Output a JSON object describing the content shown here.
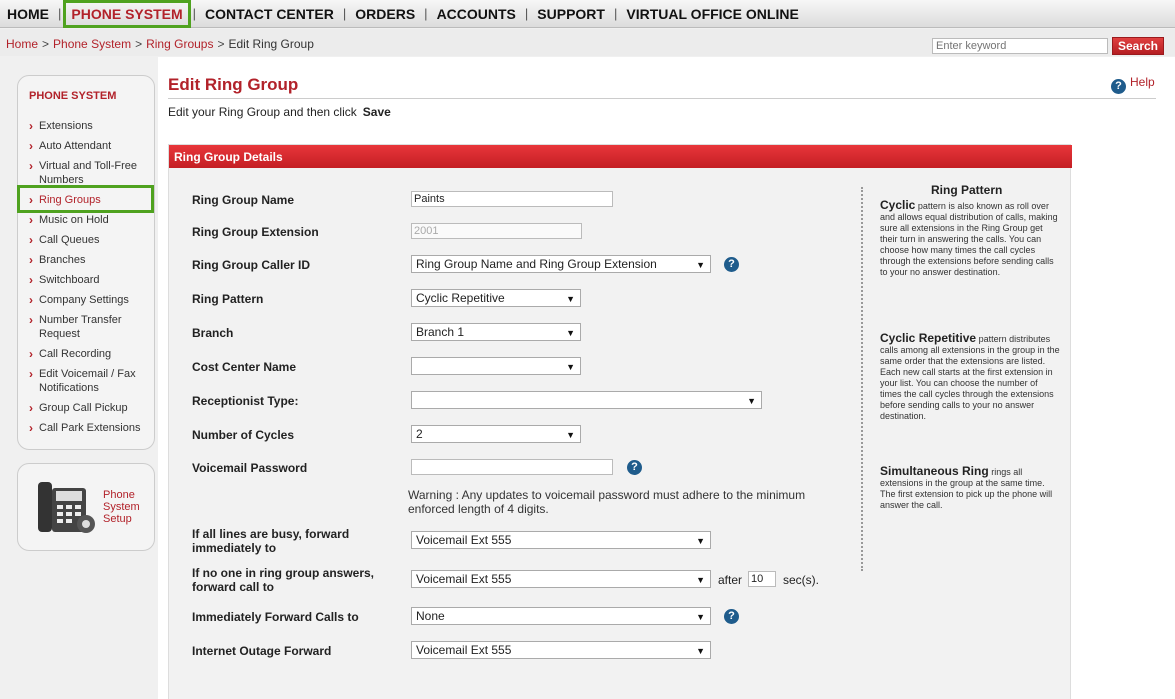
{
  "nav": {
    "items": [
      {
        "label": "HOME"
      },
      {
        "label": "PHONE SYSTEM"
      },
      {
        "label": "CONTACT CENTER"
      },
      {
        "label": "ORDERS"
      },
      {
        "label": "ACCOUNTS"
      },
      {
        "label": "SUPPORT"
      },
      {
        "label": "VIRTUAL OFFICE ONLINE"
      }
    ],
    "active": "PHONE SYSTEM"
  },
  "breadcrumb": {
    "items": [
      "Home",
      "Phone System",
      "Ring Groups"
    ],
    "current": "Edit Ring Group",
    "separator": ">"
  },
  "search": {
    "placeholder": "Enter keyword",
    "button": "Search"
  },
  "sidebar": {
    "title": "PHONE SYSTEM",
    "items": [
      {
        "label": "Extensions"
      },
      {
        "label": "Auto Attendant"
      },
      {
        "label": "Virtual and Toll-Free Numbers"
      },
      {
        "label": "Ring Groups"
      },
      {
        "label": "Music on Hold"
      },
      {
        "label": "Call Queues"
      },
      {
        "label": "Branches"
      },
      {
        "label": "Switchboard"
      },
      {
        "label": "Company Settings"
      },
      {
        "label": "Number Transfer Request"
      },
      {
        "label": "Call Recording"
      },
      {
        "label": "Edit Voicemail / Fax Notifications"
      },
      {
        "label": "Group Call Pickup"
      },
      {
        "label": "Call Park Extensions"
      }
    ],
    "active": "Ring Groups",
    "setup_label": "Phone System Setup"
  },
  "page": {
    "title": "Edit Ring Group",
    "help": "Help",
    "intro": "Edit your Ring Group and then click",
    "intro_action": "Save",
    "panel_title": "Ring Group Details"
  },
  "form": {
    "name_label": "Ring Group Name",
    "name_value": "Paints",
    "extension_label": "Ring Group Extension",
    "extension_value": "2001",
    "caller_id_label": "Ring Group Caller ID",
    "caller_id_value": "Ring Group Name and Ring Group Extension",
    "pattern_label": "Ring Pattern",
    "pattern_value": "Cyclic Repetitive",
    "branch_label": "Branch",
    "branch_value": "Branch 1",
    "cost_center_label": "Cost Center Name",
    "cost_center_value": "",
    "receptionist_label": "Receptionist Type:",
    "receptionist_value": "",
    "cycles_label": "Number of Cycles",
    "cycles_value": "2",
    "voicemail_label": "Voicemail Password",
    "voicemail_value": "",
    "warning": "Warning : Any updates to voicemail password must adhere to the minimum enforced length of 4 digits.",
    "busy_label": "If all lines are busy, forward immediately to",
    "busy_value": "Voicemail Ext 555",
    "no_answer_label": "If no one in ring group answers, forward call to",
    "no_answer_value": "Voicemail Ext 555",
    "after_label": "after",
    "after_value": "10",
    "secs_label": "sec(s).",
    "immediate_label": "Immediately Forward Calls to",
    "immediate_value": "None",
    "outage_label": "Internet Outage Forward",
    "outage_value": "Voicemail Ext 555"
  },
  "info": {
    "title": "Ring Pattern",
    "cyclic_head": "Cyclic",
    "cyclic_text": "pattern is also known as roll over and allows equal distribution of calls, making sure all extensions in the Ring Group get their turn in answering the calls. You can choose how many times the call cycles through the extensions before sending calls to your no answer destination.",
    "cyclic_rep_head": "Cyclic Repetitive",
    "cyclic_rep_text": "pattern distributes calls among all extensions in the group in the same order that the extensions are listed. Each new call starts at the first extension in your list. You can choose the number of times the call cycles through the extensions before sending calls to your no answer destination.",
    "simul_head": "Simultaneous Ring",
    "simul_text": "rings all extensions in the group at the same time. The first extension to pick up the phone will answer the call."
  },
  "colors": {
    "accent": "#b2222a",
    "highlight": "#4fa21f",
    "help_icon": "#1f5c8c"
  }
}
